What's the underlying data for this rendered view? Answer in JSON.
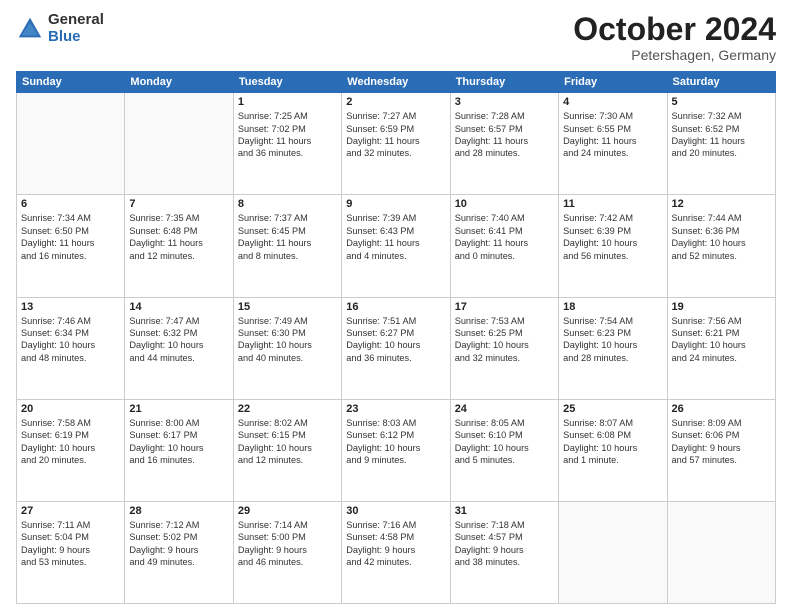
{
  "header": {
    "logo_general": "General",
    "logo_blue": "Blue",
    "title": "October 2024",
    "location": "Petershagen, Germany"
  },
  "days_of_week": [
    "Sunday",
    "Monday",
    "Tuesday",
    "Wednesday",
    "Thursday",
    "Friday",
    "Saturday"
  ],
  "weeks": [
    [
      {
        "day": "",
        "detail": ""
      },
      {
        "day": "",
        "detail": ""
      },
      {
        "day": "1",
        "detail": "Sunrise: 7:25 AM\nSunset: 7:02 PM\nDaylight: 11 hours\nand 36 minutes."
      },
      {
        "day": "2",
        "detail": "Sunrise: 7:27 AM\nSunset: 6:59 PM\nDaylight: 11 hours\nand 32 minutes."
      },
      {
        "day": "3",
        "detail": "Sunrise: 7:28 AM\nSunset: 6:57 PM\nDaylight: 11 hours\nand 28 minutes."
      },
      {
        "day": "4",
        "detail": "Sunrise: 7:30 AM\nSunset: 6:55 PM\nDaylight: 11 hours\nand 24 minutes."
      },
      {
        "day": "5",
        "detail": "Sunrise: 7:32 AM\nSunset: 6:52 PM\nDaylight: 11 hours\nand 20 minutes."
      }
    ],
    [
      {
        "day": "6",
        "detail": "Sunrise: 7:34 AM\nSunset: 6:50 PM\nDaylight: 11 hours\nand 16 minutes."
      },
      {
        "day": "7",
        "detail": "Sunrise: 7:35 AM\nSunset: 6:48 PM\nDaylight: 11 hours\nand 12 minutes."
      },
      {
        "day": "8",
        "detail": "Sunrise: 7:37 AM\nSunset: 6:45 PM\nDaylight: 11 hours\nand 8 minutes."
      },
      {
        "day": "9",
        "detail": "Sunrise: 7:39 AM\nSunset: 6:43 PM\nDaylight: 11 hours\nand 4 minutes."
      },
      {
        "day": "10",
        "detail": "Sunrise: 7:40 AM\nSunset: 6:41 PM\nDaylight: 11 hours\nand 0 minutes."
      },
      {
        "day": "11",
        "detail": "Sunrise: 7:42 AM\nSunset: 6:39 PM\nDaylight: 10 hours\nand 56 minutes."
      },
      {
        "day": "12",
        "detail": "Sunrise: 7:44 AM\nSunset: 6:36 PM\nDaylight: 10 hours\nand 52 minutes."
      }
    ],
    [
      {
        "day": "13",
        "detail": "Sunrise: 7:46 AM\nSunset: 6:34 PM\nDaylight: 10 hours\nand 48 minutes."
      },
      {
        "day": "14",
        "detail": "Sunrise: 7:47 AM\nSunset: 6:32 PM\nDaylight: 10 hours\nand 44 minutes."
      },
      {
        "day": "15",
        "detail": "Sunrise: 7:49 AM\nSunset: 6:30 PM\nDaylight: 10 hours\nand 40 minutes."
      },
      {
        "day": "16",
        "detail": "Sunrise: 7:51 AM\nSunset: 6:27 PM\nDaylight: 10 hours\nand 36 minutes."
      },
      {
        "day": "17",
        "detail": "Sunrise: 7:53 AM\nSunset: 6:25 PM\nDaylight: 10 hours\nand 32 minutes."
      },
      {
        "day": "18",
        "detail": "Sunrise: 7:54 AM\nSunset: 6:23 PM\nDaylight: 10 hours\nand 28 minutes."
      },
      {
        "day": "19",
        "detail": "Sunrise: 7:56 AM\nSunset: 6:21 PM\nDaylight: 10 hours\nand 24 minutes."
      }
    ],
    [
      {
        "day": "20",
        "detail": "Sunrise: 7:58 AM\nSunset: 6:19 PM\nDaylight: 10 hours\nand 20 minutes."
      },
      {
        "day": "21",
        "detail": "Sunrise: 8:00 AM\nSunset: 6:17 PM\nDaylight: 10 hours\nand 16 minutes."
      },
      {
        "day": "22",
        "detail": "Sunrise: 8:02 AM\nSunset: 6:15 PM\nDaylight: 10 hours\nand 12 minutes."
      },
      {
        "day": "23",
        "detail": "Sunrise: 8:03 AM\nSunset: 6:12 PM\nDaylight: 10 hours\nand 9 minutes."
      },
      {
        "day": "24",
        "detail": "Sunrise: 8:05 AM\nSunset: 6:10 PM\nDaylight: 10 hours\nand 5 minutes."
      },
      {
        "day": "25",
        "detail": "Sunrise: 8:07 AM\nSunset: 6:08 PM\nDaylight: 10 hours\nand 1 minute."
      },
      {
        "day": "26",
        "detail": "Sunrise: 8:09 AM\nSunset: 6:06 PM\nDaylight: 9 hours\nand 57 minutes."
      }
    ],
    [
      {
        "day": "27",
        "detail": "Sunrise: 7:11 AM\nSunset: 5:04 PM\nDaylight: 9 hours\nand 53 minutes."
      },
      {
        "day": "28",
        "detail": "Sunrise: 7:12 AM\nSunset: 5:02 PM\nDaylight: 9 hours\nand 49 minutes."
      },
      {
        "day": "29",
        "detail": "Sunrise: 7:14 AM\nSunset: 5:00 PM\nDaylight: 9 hours\nand 46 minutes."
      },
      {
        "day": "30",
        "detail": "Sunrise: 7:16 AM\nSunset: 4:58 PM\nDaylight: 9 hours\nand 42 minutes."
      },
      {
        "day": "31",
        "detail": "Sunrise: 7:18 AM\nSunset: 4:57 PM\nDaylight: 9 hours\nand 38 minutes."
      },
      {
        "day": "",
        "detail": ""
      },
      {
        "day": "",
        "detail": ""
      }
    ]
  ]
}
